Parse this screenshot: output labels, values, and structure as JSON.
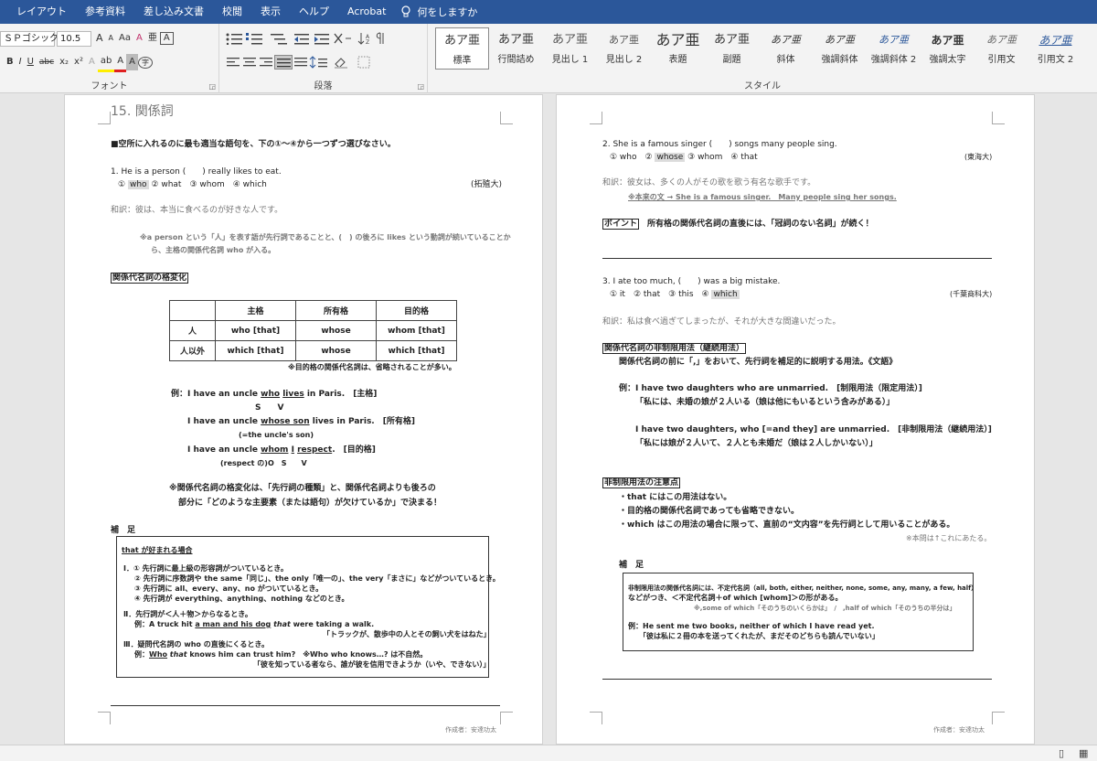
{
  "menu": [
    "レイアウト",
    "参考資料",
    "差し込み文書",
    "校閲",
    "表示",
    "ヘルプ",
    "Acrobat"
  ],
  "tell_me": "何をしますか",
  "ribbon": {
    "font": {
      "label": "フォント",
      "name": "ＳＰゴシック",
      "size": "10.5",
      "grow": "A",
      "shrink": "A",
      "case": "Aa",
      "clear": "A",
      "furigana": "亜",
      "enclose": "A",
      "bold": "B",
      "italic": "I",
      "underline": "U",
      "strike": "abc",
      "sub": "x₂",
      "sup": "x²",
      "effect": "A",
      "highlight": "ab",
      "color": "A",
      "shade": "A",
      "enclosed": "字"
    },
    "para": {
      "label": "段落"
    },
    "styles": {
      "label": "スタイル",
      "items": [
        {
          "preview": "あア亜",
          "name": "標準",
          "selected": true
        },
        {
          "preview": "あア亜",
          "name": "行間詰め"
        },
        {
          "preview": "あア亜",
          "name": "見出し 1"
        },
        {
          "preview": "あア亜",
          "name": "見出し 2"
        },
        {
          "preview": "あア亜",
          "name": "表題"
        },
        {
          "preview": "あア亜",
          "name": "副題"
        },
        {
          "preview": "あア亜",
          "name": "斜体"
        },
        {
          "preview": "あア亜",
          "name": "強調斜体"
        },
        {
          "preview": "あア亜",
          "name": "強調斜体 2"
        },
        {
          "preview": "あア亜",
          "name": "強調太字"
        },
        {
          "preview": "あア亜",
          "name": "引用文"
        },
        {
          "preview": "あア亜",
          "name": "引用文 2"
        }
      ]
    }
  },
  "left": {
    "title": "15. 関係詞",
    "instruction": "■空所に入れるのに最も適当な語句を、下の①～④から一つずつ選びなさい。",
    "q1": "1. He is a person (　　) really likes to eat.",
    "q1_o1": "①",
    "q1_o1w": "who",
    "q1_o2": "② what　③ whom　④ which",
    "q1_src": "(拓殖大)",
    "q1_trans": "和訳：彼は、本当に食べるのが好きな人です。",
    "note1": "※a person という「人」を表す語が先行詞であることと、(　) の後ろに likes という動詞が続いていることか",
    "note1b": "ら、主格の関係代名詞 who が入る。",
    "case_heading": "関係代名詞の格変化",
    "table": {
      "headers": [
        "",
        "主格",
        "所有格",
        "目的格"
      ],
      "rows": [
        [
          "人",
          "who [that]",
          "whose",
          "whom [that]"
        ],
        [
          "人以外",
          "which [that]",
          "whose",
          "which [that]"
        ]
      ]
    },
    "table_note": "※目的格の関係代名詞は、省略されることが多い。",
    "ex1a": "例：I have an uncle ",
    "ex1w1": "who",
    "ex1w2": "lives",
    "ex1b": " in Paris.　[主格]",
    "ex1sv": "S　　V",
    "ex2a": "I have an uncle ",
    "ex2w": "whose son",
    "ex2b": " lives in Paris.　[所有格]",
    "ex2n": "(=the uncle's son)",
    "ex3a": "I have an uncle ",
    "ex3w1": "whom",
    "ex3w2": "I",
    "ex3w3": "respect",
    "ex3b": ".　[目的格]",
    "ex3n": "(respect の)O　S　　V",
    "summary1": "※関係代名詞の格変化は、「先行詞の種類」と、関係代名詞よりも後ろの",
    "summary2": "部分に「どのような主要素（または語句）が欠けているか」で決まる！",
    "supp": "補　足",
    "box": {
      "heading": "that が好まれる場合",
      "l1": "Ⅰ．① 先行詞に最上級の形容詞がついているとき。",
      "l2": "② 先行詞に序数詞や the same「同じ」、the only「唯一の」、the very「まさに」などがついているとき。",
      "l3": "③ 先行詞に all、every、any、no がついているとき。",
      "l4": "④ 先行詞が everything、anything、nothing などのとき。",
      "l5": "Ⅱ．先行詞が＜人＋物＞からなるとき。",
      "l6a": "例：A truck hit ",
      "l6u": "a man and his dog",
      "l6i": " that",
      "l6b": " were taking a walk.",
      "l7": "「トラックが、散歩中の人とその飼い犬をはねた」",
      "l8": "Ⅲ．疑問代名詞の who の直後にくるとき。",
      "l9a": "例：",
      "l9u": "Who",
      "l9i": " that",
      "l9b": " knows him can trust him?　※Who who knows…? は不自然。",
      "l10": "「彼を知っている者なら、誰が彼を信用できようか（いや、できない）」"
    },
    "author": "作成者：安達功太"
  },
  "right": {
    "q2": "2. She is a famous singer (　　) songs many people sing.",
    "q2_o1": "① who　",
    "q2_o2": "②",
    "q2_o2w": "whose",
    "q2_o3": "③ whom　④ that",
    "q2_src": "(東海大)",
    "q2_trans": "和訳：彼女は、多くの人がその歌を歌う有名な歌手です。",
    "q2_note": "※本来の文 → She is a famous singer.　Many people sing her songs.",
    "point_label": "ポイント",
    "point_text": "所有格の関係代名詞の直後には、「冠詞のない名詞」が続く！",
    "q3": "3. I ate too much, (　　) was a big mistake.",
    "q3_o1": "① it　② that　③ this　",
    "q3_o4": "④",
    "q3_o4w": "which",
    "q3_src": "(千葉商科大)",
    "q3_trans": "和訳：私は食べ過ぎてしまったが、それが大きな間違いだった。",
    "nr_heading": "関係代名詞の非制限用法（継続用法）",
    "nr_def": "関係代名詞の前に「,」をおいて、先行詞を補足的に説明する用法。《文語》",
    "nr_ex1": "例：I have two daughters who are unmarried.　[制限用法（限定用法）]",
    "nr_ex1t": "「私には、未婚の娘が２人いる（娘は他にもいるという含みがある）」",
    "nr_ex2": "I have two daughters, who [=and they] are unmarried.　[非制限用法（継続用法）]",
    "nr_ex2t": "「私には娘が２人いて、２人とも未婚だ（娘は２人しかいない）」",
    "caution_heading": "非制限用法の注意点",
    "c1": "・that にはこの用法はない。",
    "c2": "・目的格の関係代名詞であっても省略できない。",
    "c3": "・which はこの用法の場合に限って、直前の“文内容”を先行詞として用いることがある。",
    "c3n": "※本問は↑これにあたる。",
    "supp": "補　足",
    "box": {
      "l1": "非制限用法の関係代名詞には、不定代名詞（all, both, either, neither, none, some, any, many, a few, half）",
      "l2": "などがつき、＜不定代名詞＋of which [whom]＞の形がある。",
      "l3": "※,some of which「そのうちのいくらかは」　/　,half of which「そのうちの半分は」",
      "l4": "例：He sent me two books, neither of which I have read yet.",
      "l5": "「彼は私に２冊の本を送ってくれたが、まだそのどちらも読んでいない」"
    },
    "author": "作成者：安達功太"
  },
  "ret": "↵",
  "status": {
    "read": "▯",
    "print": "▦"
  }
}
